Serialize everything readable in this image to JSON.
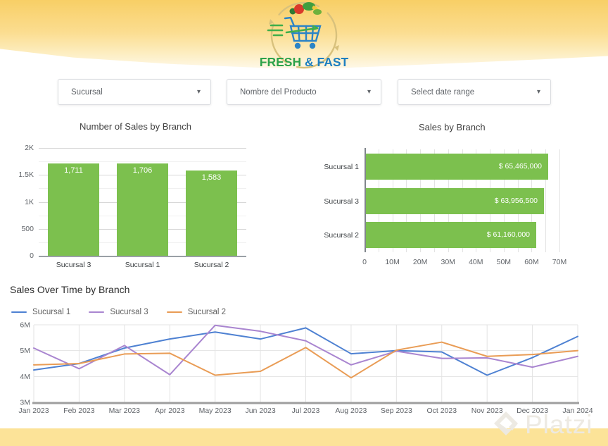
{
  "icons": {
    "dropdown_caret": "▾"
  },
  "header": {
    "logo": {
      "fresh": "FRESH",
      "amp_fast": "& FAST"
    },
    "colors": {
      "banner_yellow": "#f8cf66",
      "footer_yellow": "#fce398",
      "logo_green": "#2ca24a",
      "logo_blue": "#1d7fc0",
      "ring_tan": "#d8c17c"
    }
  },
  "filters": [
    {
      "label": "Sucursal"
    },
    {
      "label": "Nombre del Producto"
    },
    {
      "label": "Select date range"
    }
  ],
  "chart_data": [
    {
      "type": "bar",
      "orientation": "vertical",
      "title": "Number of Sales by Branch",
      "categories": [
        "Sucursal 3",
        "Sucursal 1",
        "Sucursal 2"
      ],
      "values": [
        1711,
        1706,
        1583
      ],
      "value_labels": [
        "1,711",
        "1,706",
        "1,583"
      ],
      "ylim": [
        0,
        2000
      ],
      "yticks": [
        {
          "v": 0,
          "label": "0"
        },
        {
          "v": 500,
          "label": "500"
        },
        {
          "v": 1000,
          "label": "1K"
        },
        {
          "v": 1500,
          "label": "1.5K"
        },
        {
          "v": 2000,
          "label": "2K"
        }
      ],
      "minor_grid_step": 250,
      "bar_color": "#7cc04e",
      "grid": true
    },
    {
      "type": "bar",
      "orientation": "horizontal",
      "title": "Sales by Branch",
      "categories": [
        "Sucursal 1",
        "Sucursal 3",
        "Sucursal 2"
      ],
      "values": [
        65465000,
        63956500,
        61160000
      ],
      "value_labels": [
        "$ 65,465,000",
        "$ 63,956,500",
        "$ 61,160,000"
      ],
      "xlim": [
        0,
        70000000
      ],
      "xticks": [
        {
          "v": 0,
          "label": "0"
        },
        {
          "v": 10000000,
          "label": "10M"
        },
        {
          "v": 20000000,
          "label": "20M"
        },
        {
          "v": 30000000,
          "label": "30M"
        },
        {
          "v": 40000000,
          "label": "40M"
        },
        {
          "v": 50000000,
          "label": "50M"
        },
        {
          "v": 60000000,
          "label": "60M"
        },
        {
          "v": 70000000,
          "label": "70M"
        }
      ],
      "minor_grid_step": 5000000,
      "bar_color": "#7cc04e",
      "grid": true
    },
    {
      "type": "line",
      "title": "Sales Over Time by Branch",
      "x": [
        "Jan 2023",
        "Feb 2023",
        "Mar 2023",
        "Apr 2023",
        "May 2023",
        "Jun 2023",
        "Jul 2023",
        "Aug 2023",
        "Sep 2023",
        "Oct 2023",
        "Nov 2023",
        "Dec 2023",
        "Jan 2024"
      ],
      "y_unit": "millions",
      "ylim": [
        3,
        6
      ],
      "yticks": [
        {
          "v": 3,
          "label": "3M"
        },
        {
          "v": 4,
          "label": "4M"
        },
        {
          "v": 5,
          "label": "5M"
        },
        {
          "v": 6,
          "label": "6M"
        }
      ],
      "grid": true,
      "legend_position": "top-left",
      "series": [
        {
          "name": "Sucursal 1",
          "color": "#4e81d2",
          "values": [
            4.25,
            4.5,
            5.1,
            5.45,
            5.72,
            5.45,
            5.88,
            4.88,
            5.0,
            4.95,
            4.05,
            4.73,
            5.55
          ]
        },
        {
          "name": "Sucursal 3",
          "color": "#a985d0",
          "values": [
            5.1,
            4.3,
            5.2,
            4.07,
            5.98,
            5.75,
            5.38,
            4.45,
            4.98,
            4.7,
            4.72,
            4.36,
            4.78
          ]
        },
        {
          "name": "Sucursal 2",
          "color": "#e99c55",
          "values": [
            4.45,
            4.5,
            4.87,
            4.9,
            4.05,
            4.2,
            5.12,
            3.95,
            5.02,
            5.33,
            4.78,
            4.85,
            5.0
          ]
        }
      ]
    }
  ],
  "watermark": {
    "text": "Platzi"
  }
}
